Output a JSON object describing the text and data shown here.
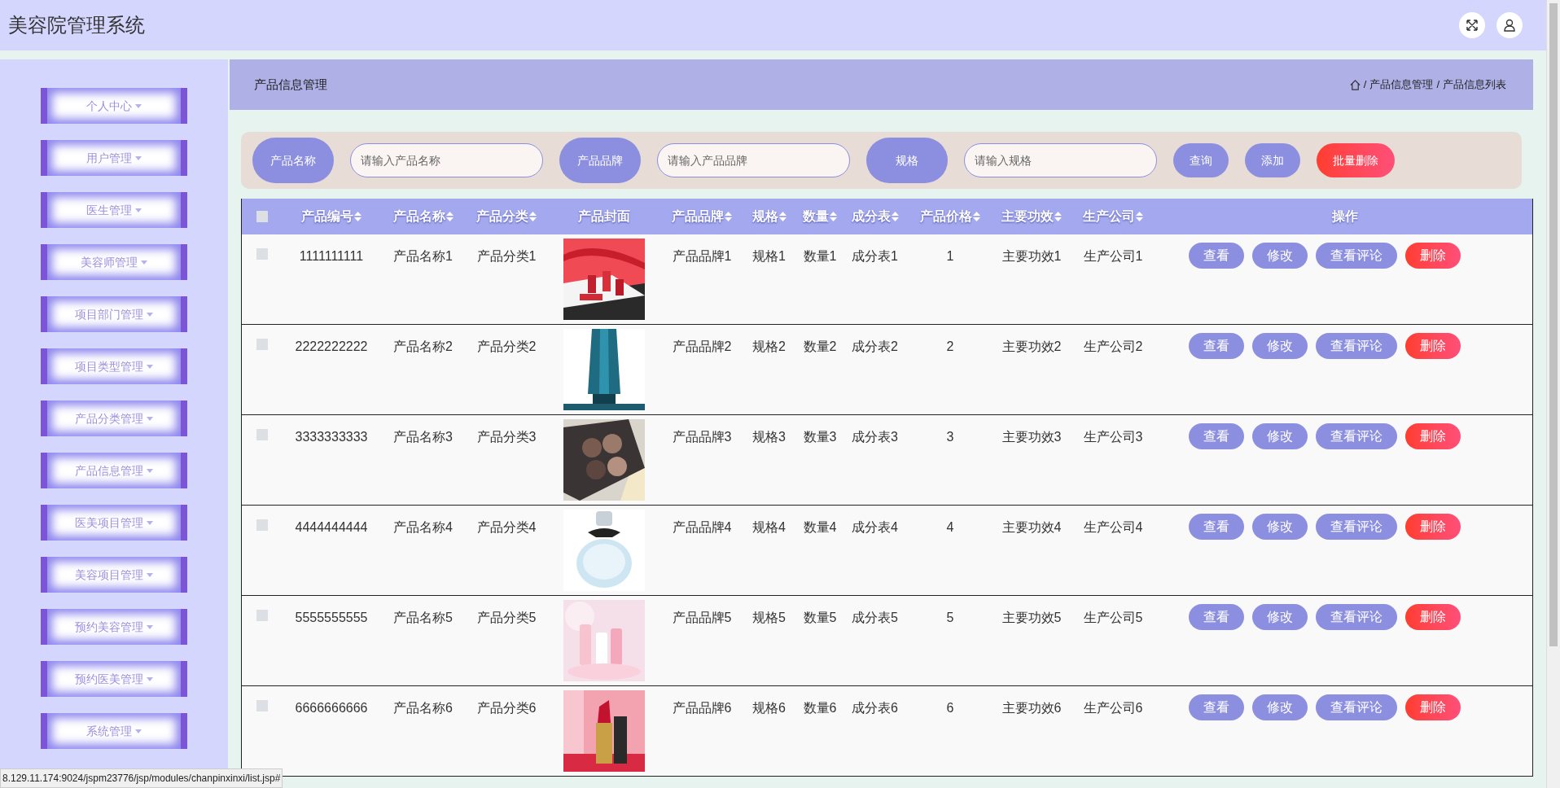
{
  "app_title": "美容院管理系统",
  "breadcrumb_bar": {
    "title": "产品信息管理",
    "separator": "/",
    "path": [
      "产品信息管理",
      "产品信息列表"
    ]
  },
  "sidebar": {
    "items": [
      {
        "label": "个人中心"
      },
      {
        "label": "用户管理"
      },
      {
        "label": "医生管理"
      },
      {
        "label": "美容师管理"
      },
      {
        "label": "项目部门管理"
      },
      {
        "label": "项目类型管理"
      },
      {
        "label": "产品分类管理"
      },
      {
        "label": "产品信息管理"
      },
      {
        "label": "医美项目管理"
      },
      {
        "label": "美容项目管理"
      },
      {
        "label": "预约美容管理"
      },
      {
        "label": "预约医美管理"
      },
      {
        "label": "系统管理"
      }
    ]
  },
  "search": {
    "fields": [
      {
        "label": "产品名称",
        "placeholder": "请输入产品名称"
      },
      {
        "label": "产品品牌",
        "placeholder": "请输入产品品牌"
      },
      {
        "label": "规格",
        "placeholder": "请输入规格"
      }
    ],
    "buttons": [
      {
        "label": "查询",
        "kind": "primary"
      },
      {
        "label": "添加",
        "kind": "primary"
      },
      {
        "label": "批量删除",
        "kind": "danger"
      }
    ]
  },
  "table": {
    "select_all_checked": false,
    "columns": [
      {
        "label": "产品编号",
        "kind": "text",
        "sortable": true
      },
      {
        "label": "产品名称",
        "kind": "text",
        "sortable": true
      },
      {
        "label": "产品分类",
        "kind": "text",
        "sortable": true
      },
      {
        "label": "产品封面",
        "sortable": false
      },
      {
        "label": "产品品牌",
        "kind": "text",
        "sortable": true
      },
      {
        "label": "规格",
        "kind": "text",
        "sortable": true
      },
      {
        "label": "数量",
        "kind": "text",
        "sortable": true
      },
      {
        "label": "成分表",
        "kind": "text",
        "sortable": true
      },
      {
        "label": "产品价格",
        "kind": "text",
        "sortable": true
      },
      {
        "label": "主要功效",
        "kind": "text",
        "sortable": true
      },
      {
        "label": "生产公司",
        "kind": "text",
        "sortable": true
      },
      {
        "label": "操作",
        "kind": "actions",
        "sortable": false
      }
    ],
    "rows": [
      {
        "checked": false,
        "cells": [
          "1111111111",
          "产品名称1",
          "产品分类1",
          {
            "kind": "picture"
          },
          "产品品牌1",
          "规格1",
          "数量1",
          "成分表1",
          "1",
          "主要功效1",
          "生产公司1"
        ],
        "actions": [
          {
            "label": "查看",
            "kind": "primary"
          },
          {
            "label": "修改",
            "kind": "primary"
          },
          {
            "label": "查看评论",
            "kind": "primary"
          },
          {
            "label": "删除",
            "kind": "danger"
          }
        ]
      },
      {
        "checked": false,
        "cells": [
          "2222222222",
          "产品名称2",
          "产品分类2",
          {
            "kind": "picture"
          },
          "产品品牌2",
          "规格2",
          "数量2",
          "成分表2",
          "2",
          "主要功效2",
          "生产公司2"
        ],
        "actions": [
          {
            "label": "查看",
            "kind": "primary"
          },
          {
            "label": "修改",
            "kind": "primary"
          },
          {
            "label": "查看评论",
            "kind": "primary"
          },
          {
            "label": "删除",
            "kind": "danger"
          }
        ]
      },
      {
        "checked": false,
        "cells": [
          "3333333333",
          "产品名称3",
          "产品分类3",
          {
            "kind": "picture"
          },
          "产品品牌3",
          "规格3",
          "数量3",
          "成分表3",
          "3",
          "主要功效3",
          "生产公司3"
        ],
        "actions": [
          {
            "label": "查看",
            "kind": "primary"
          },
          {
            "label": "修改",
            "kind": "primary"
          },
          {
            "label": "查看评论",
            "kind": "primary"
          },
          {
            "label": "删除",
            "kind": "danger"
          }
        ]
      },
      {
        "checked": false,
        "cells": [
          "4444444444",
          "产品名称4",
          "产品分类4",
          {
            "kind": "picture"
          },
          "产品品牌4",
          "规格4",
          "数量4",
          "成分表4",
          "4",
          "主要功效4",
          "生产公司4"
        ],
        "actions": [
          {
            "label": "查看",
            "kind": "primary"
          },
          {
            "label": "修改",
            "kind": "primary"
          },
          {
            "label": "查看评论",
            "kind": "primary"
          },
          {
            "label": "删除",
            "kind": "danger"
          }
        ]
      },
      {
        "checked": false,
        "cells": [
          "5555555555",
          "产品名称5",
          "产品分类5",
          {
            "kind": "picture"
          },
          "产品品牌5",
          "规格5",
          "数量5",
          "成分表5",
          "5",
          "主要功效5",
          "生产公司5"
        ],
        "actions": [
          {
            "label": "查看",
            "kind": "primary"
          },
          {
            "label": "修改",
            "kind": "primary"
          },
          {
            "label": "查看评论",
            "kind": "primary"
          },
          {
            "label": "删除",
            "kind": "danger"
          }
        ]
      },
      {
        "checked": false,
        "cells": [
          "6666666666",
          "产品名称6",
          "产品分类6",
          {
            "kind": "picture"
          },
          "产品品牌6",
          "规格6",
          "数量6",
          "成分表6",
          "6",
          "主要功效6",
          "生产公司6"
        ],
        "actions": [
          {
            "label": "查看",
            "kind": "primary"
          },
          {
            "label": "修改",
            "kind": "primary"
          },
          {
            "label": "查看评论",
            "kind": "primary"
          },
          {
            "label": "删除",
            "kind": "danger"
          }
        ]
      }
    ]
  },
  "status_url": "8.129.11.174:9024/jspm23776/jsp/modules/chanpinxinxi/list.jsp#"
}
